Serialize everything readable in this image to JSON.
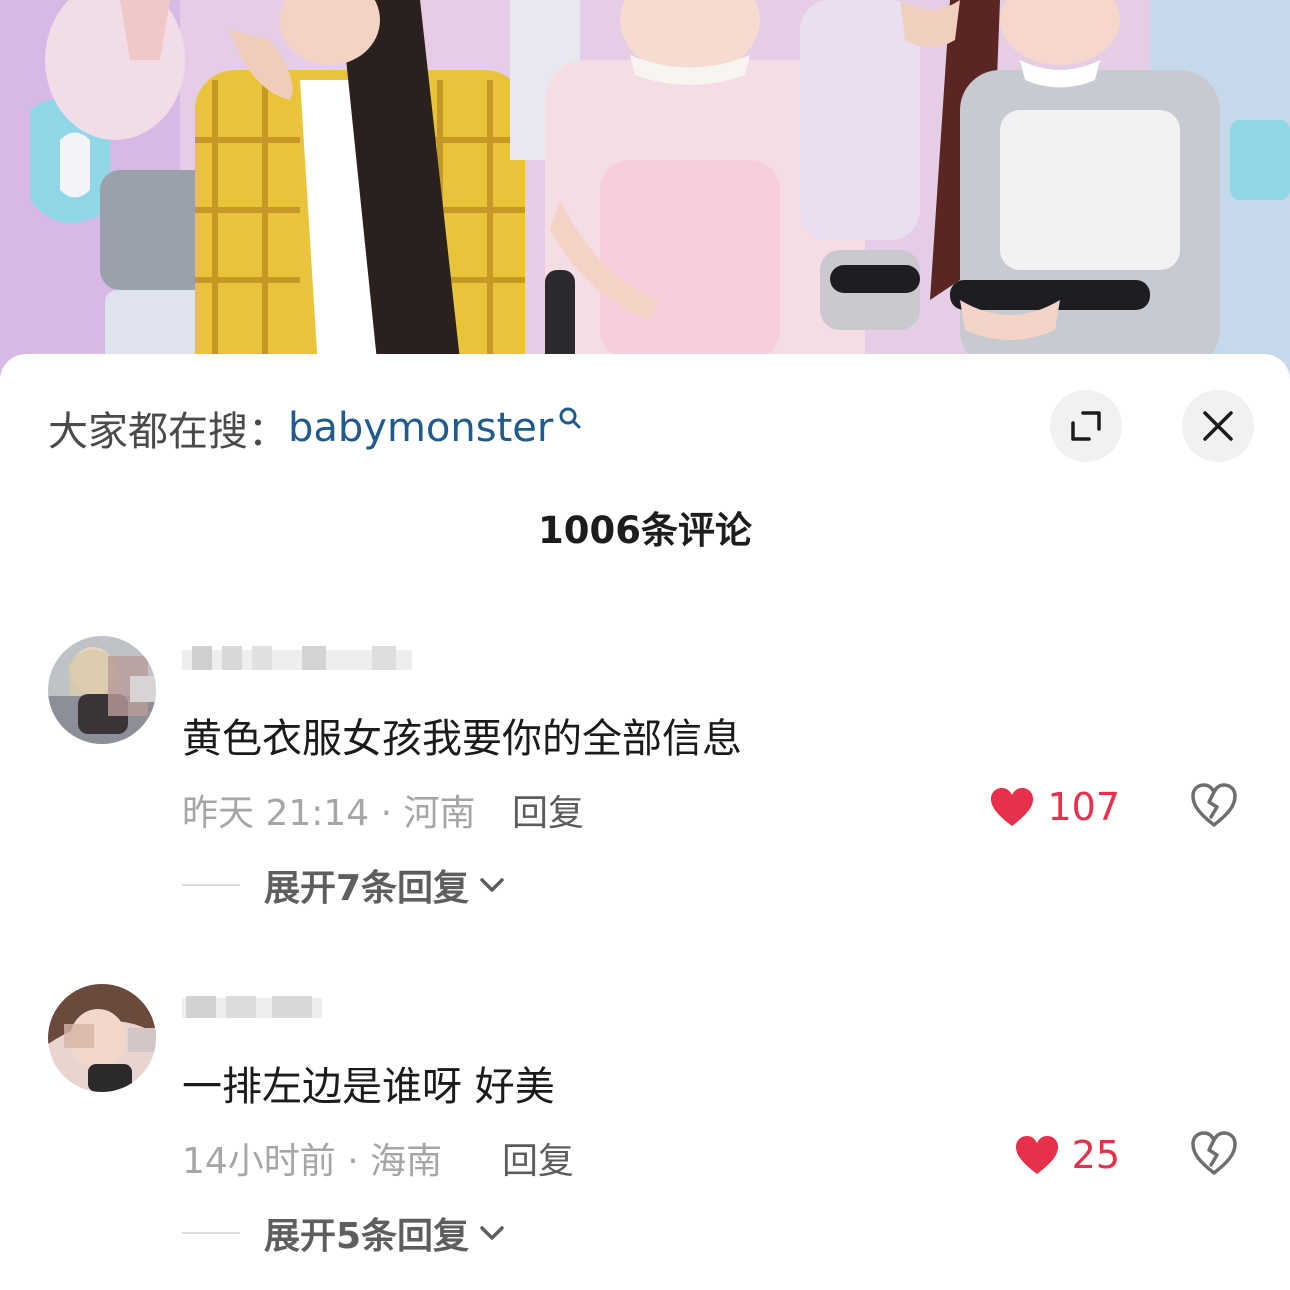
{
  "search": {
    "prefix": "大家都在搜：",
    "term": "babymonster"
  },
  "comments_header": {
    "count_text": "1006条评论"
  },
  "comments": [
    {
      "username": "",
      "text": "黄色衣服女孩我要你的全部信息",
      "time_location": "昨天 21:14 · 河南",
      "reply_label": "回复",
      "likes": "107",
      "expand_label": "展开7条回复"
    },
    {
      "username": "",
      "text": "一排左边是谁呀 好美",
      "time_location": "14小时前 · 海南",
      "reply_label": "回复",
      "likes": "25",
      "expand_label": "展开5条回复"
    }
  ],
  "colors": {
    "accent_like": "#e8304a",
    "search_term": "#1f5b8f",
    "text_primary": "#1b1b1b",
    "text_meta": "#a6a6a6",
    "button_bg": "#f1f1f1"
  },
  "icons": {
    "search": "search-icon",
    "expand": "expand-icon",
    "close": "close-icon",
    "like": "heart-icon",
    "dislike": "broken-heart-icon",
    "expand_replies": "chevron-down-icon"
  }
}
